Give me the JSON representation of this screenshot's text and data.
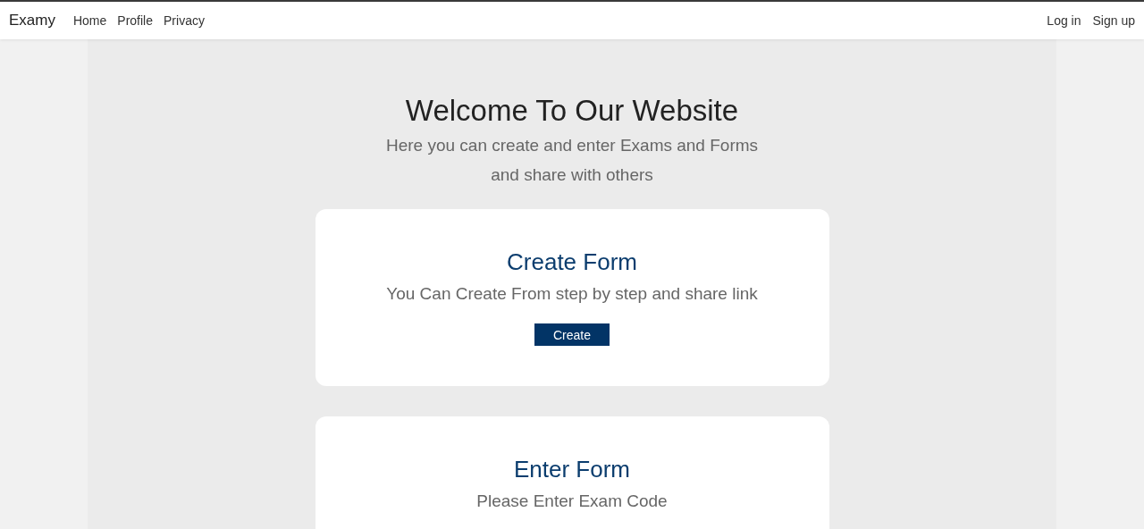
{
  "navbar": {
    "brand": "Examy",
    "links": [
      "Home",
      "Profile",
      "Privacy"
    ],
    "account_links": [
      "Log in",
      "Sign up"
    ]
  },
  "hero": {
    "title": "Welcome To Our Website",
    "subtitle": "Here you can create and enter Exams and Forms and share with others"
  },
  "cards": [
    {
      "title": "Create Form",
      "text": "You Can Create From step by step and share link",
      "button": "Create"
    },
    {
      "title": "Enter Form",
      "text": "Please Enter Exam Code"
    }
  ]
}
